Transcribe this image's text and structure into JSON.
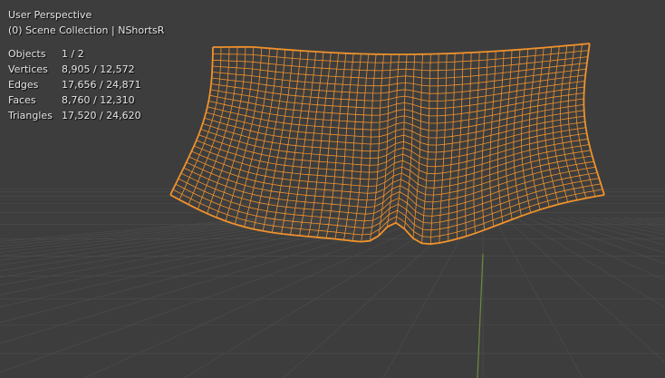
{
  "viewport": {
    "view_name": "User Perspective",
    "collection": "(0) Scene Collection | NShortsR",
    "stats": [
      {
        "label": "Objects",
        "value": "1 / 2"
      },
      {
        "label": "Vertices",
        "value": "8,905 / 12,572"
      },
      {
        "label": "Edges",
        "value": "17,656 / 24,871"
      },
      {
        "label": "Faces",
        "value": "8,760 / 12,310"
      },
      {
        "label": "Triangles",
        "value": "17,520 / 24,620"
      }
    ]
  },
  "colors": {
    "background": "#3d3d3d",
    "grid": "#4a4a4a",
    "wire": "#f0922c",
    "y_axis": "#6e8b3d"
  }
}
